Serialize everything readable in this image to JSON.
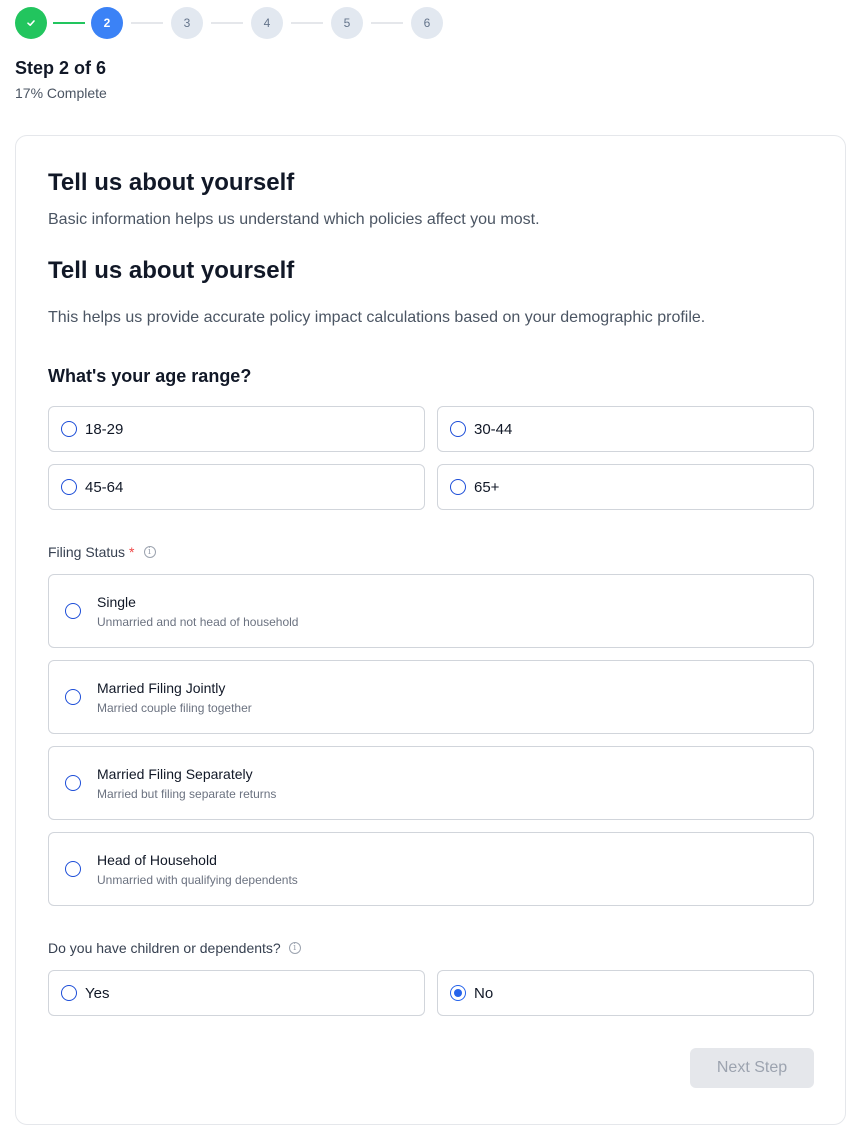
{
  "stepper": {
    "steps": [
      {
        "label": "✓",
        "state": "done"
      },
      {
        "label": "2",
        "state": "active"
      },
      {
        "label": "3",
        "state": "pending"
      },
      {
        "label": "4",
        "state": "pending"
      },
      {
        "label": "5",
        "state": "pending"
      },
      {
        "label": "6",
        "state": "pending"
      }
    ],
    "title": "Step 2 of 6",
    "progress_text": "17% Complete",
    "progress_percent": 17
  },
  "header": {
    "heading": "Tell us about yourself",
    "subheading": "Basic information helps us understand which policies affect you most.",
    "heading2": "Tell us about yourself",
    "subheading2": "This helps us provide accurate policy impact calculations based on your demographic profile."
  },
  "age": {
    "question": "What's your age range?",
    "options": [
      "18-29",
      "30-44",
      "45-64",
      "65+"
    ],
    "selected": null
  },
  "filing": {
    "label": "Filing Status",
    "required_mark": "*",
    "options": [
      {
        "title": "Single",
        "desc": "Unmarried and not head of household"
      },
      {
        "title": "Married Filing Jointly",
        "desc": "Married couple filing together"
      },
      {
        "title": "Married Filing Separately",
        "desc": "Married but filing separate returns"
      },
      {
        "title": "Head of Household",
        "desc": "Unmarried with qualifying dependents"
      }
    ],
    "selected": null
  },
  "dependents": {
    "label": "Do you have children or dependents?",
    "options": [
      "Yes",
      "No"
    ],
    "selected": "No"
  },
  "actions": {
    "next_label": "Next Step",
    "next_disabled": true
  },
  "colors": {
    "accent": "#3b82f6",
    "success": "#22c55e",
    "required": "#ef4444"
  },
  "icons": {
    "done_step": "check-icon",
    "info": "info-icon"
  }
}
